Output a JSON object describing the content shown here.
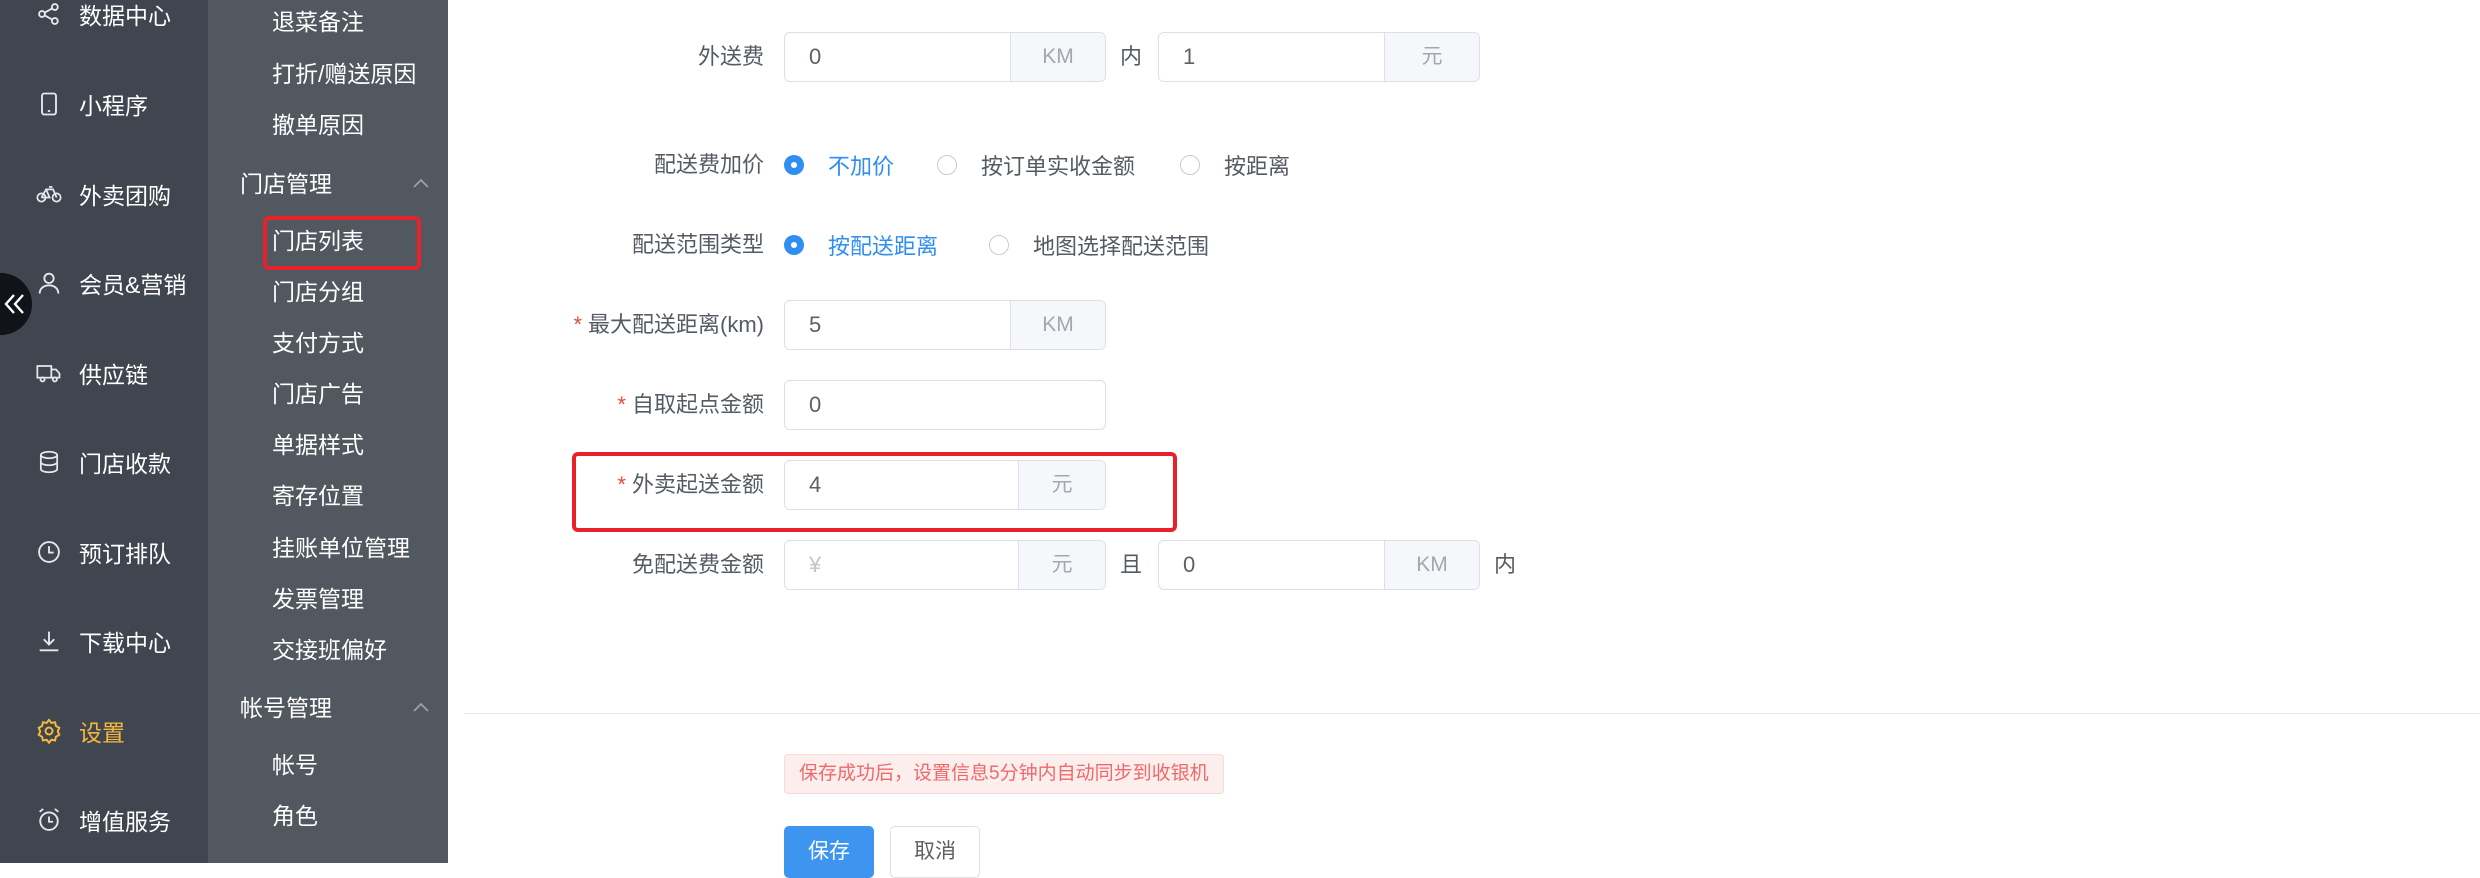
{
  "rail": {
    "items": [
      {
        "label": "数据中心",
        "icon": "share-icon"
      },
      {
        "label": "小程序",
        "icon": "mobile-icon"
      },
      {
        "label": "外卖团购",
        "icon": "bicycle-icon"
      },
      {
        "label": "会员&营销",
        "icon": "user-icon"
      },
      {
        "label": "供应链",
        "icon": "truck-icon"
      },
      {
        "label": "门店收款",
        "icon": "database-icon"
      },
      {
        "label": "预订排队",
        "icon": "clock-icon"
      },
      {
        "label": "下载中心",
        "icon": "download-icon"
      },
      {
        "label": "设置",
        "icon": "gear-icon",
        "active": true
      },
      {
        "label": "增值服务",
        "icon": "alarm-clock-icon"
      }
    ]
  },
  "submenu": {
    "top_items": [
      "退菜备注",
      "打折/赠送原因",
      "撤单原因"
    ],
    "store_group": {
      "title": "门店管理",
      "items": [
        "门店列表",
        "门店分组",
        "支付方式",
        "门店广告",
        "单据样式",
        "寄存位置",
        "挂账单位管理",
        "发票管理",
        "交接班偏好"
      ]
    },
    "account_group": {
      "title": "帐号管理",
      "items": [
        "帐号",
        "角色"
      ]
    },
    "selected": "门店列表"
  },
  "form": {
    "delivery_fee": {
      "label": "外送费",
      "distance_value": "0",
      "distance_unit": "KM",
      "connector": "内",
      "fee_value": "1",
      "fee_unit": "元"
    },
    "fee_markup": {
      "label": "配送费加价",
      "options": [
        "不加价",
        "按订单实收金额",
        "按距离"
      ],
      "selected_index": 0
    },
    "range_type": {
      "label": "配送范围类型",
      "options": [
        "按配送距离",
        "地图选择配送范围"
      ],
      "selected_index": 0
    },
    "max_distance": {
      "required_mark": "*",
      "label": "最大配送距离(km)",
      "value": "5",
      "unit": "KM"
    },
    "pickup_min": {
      "required_mark": "*",
      "label": "自取起点金额",
      "value": "0"
    },
    "delivery_min": {
      "required_mark": "*",
      "label": "外卖起送金额",
      "value": "4",
      "unit": "元"
    },
    "free_delivery": {
      "label": "免配送费金额",
      "amount_placeholder": "¥",
      "amount_unit": "元",
      "connector": "且",
      "distance_value": "0",
      "distance_unit": "KM",
      "suffix": "内"
    }
  },
  "tip": "保存成功后，设置信息5分钟内自动同步到收银机",
  "buttons": {
    "save": "保存",
    "cancel": "取消"
  },
  "colors": {
    "rail_bg": "#3f4650",
    "submenu_bg": "#515860",
    "active": "#f5b83d",
    "primary": "#3e95f0",
    "highlight": "#e8212a",
    "required": "#e8493f"
  }
}
